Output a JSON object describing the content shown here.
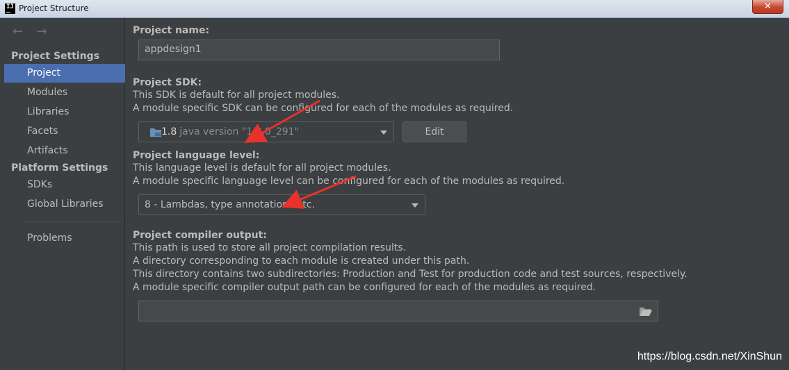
{
  "window": {
    "title": "Project Structure",
    "app_icon_text": "IJ",
    "close_glyph": "✕"
  },
  "nav": {
    "back_glyph": "←",
    "forward_glyph": "→"
  },
  "sidebar": {
    "project_settings_header": "Project Settings",
    "project_settings_items": [
      "Project",
      "Modules",
      "Libraries",
      "Facets",
      "Artifacts"
    ],
    "platform_settings_header": "Platform Settings",
    "platform_settings_items": [
      "SDKs",
      "Global Libraries"
    ],
    "problems": "Problems",
    "selected": "Project"
  },
  "main": {
    "project_name": {
      "label": "Project name:",
      "value": "appdesign1"
    },
    "sdk": {
      "label": "Project SDK:",
      "desc": [
        "This SDK is default for all project modules.",
        "A module specific SDK can be configured for each of the modules as required."
      ],
      "version": "1.8",
      "detail": "java version \"1.8.0_291\"",
      "edit_label": "Edit"
    },
    "language_level": {
      "label": "Project language level:",
      "desc": [
        "This language level is default for all project modules.",
        "A module specific language level can be configured for each of the modules as required."
      ],
      "value": "8 - Lambdas, type annotations etc."
    },
    "compiler_output": {
      "label": "Project compiler output:",
      "desc": [
        "This path is used to store all project compilation results.",
        "A directory corresponding to each module is created under this path.",
        "This directory contains two subdirectories: Production and Test for production code and test sources, respectively.",
        "A module specific compiler output path can be configured for each of the modules as required."
      ],
      "value": ""
    }
  },
  "watermark": "https://blog.csdn.net/XinShun",
  "colors": {
    "background": "#3c3f41",
    "selection": "#4b6eaf",
    "text": "#bbbbbb",
    "annotation_arrow": "#e8322b"
  },
  "icons": [
    "app-icon",
    "close-icon",
    "back-arrow-icon",
    "forward-arrow-icon",
    "folder-icon",
    "chevron-down-icon",
    "browse-folder-icon"
  ]
}
